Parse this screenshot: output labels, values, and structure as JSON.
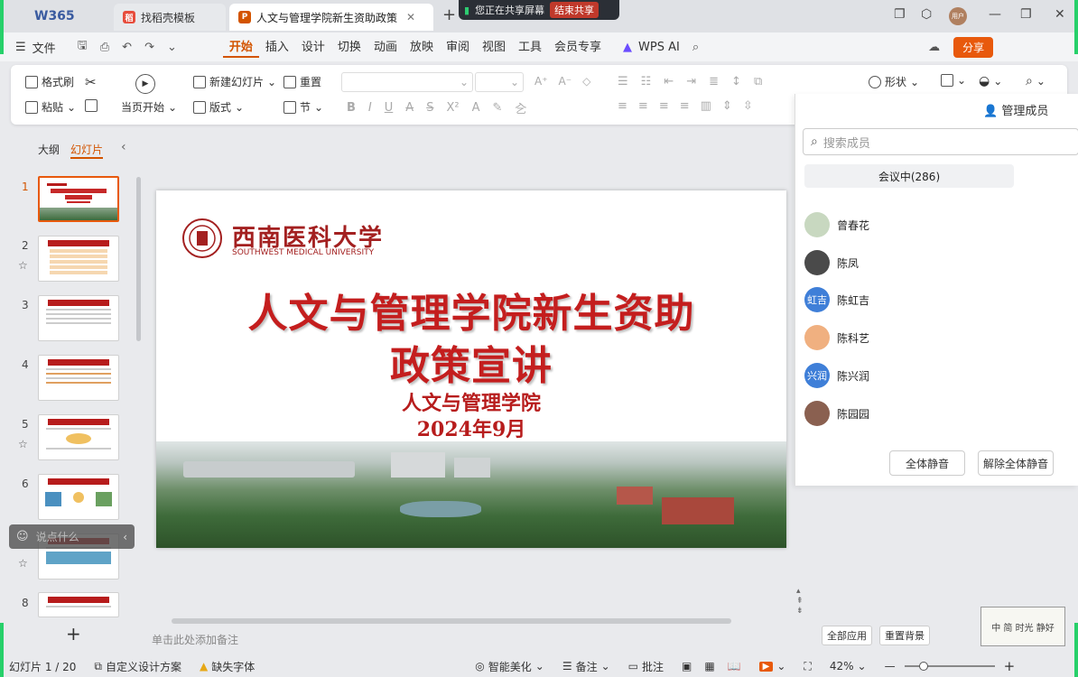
{
  "titlebar": {
    "logo": "W365",
    "tabs": [
      {
        "label": "找稻壳模板",
        "active": false
      },
      {
        "label": "人文与管理学院新生资助政策",
        "active": true
      }
    ],
    "share": {
      "status": "您正在共享屏幕",
      "end_label": "结束共享"
    },
    "user_avatar": "用户"
  },
  "menu": {
    "file": "文件",
    "items": [
      "开始",
      "插入",
      "设计",
      "切换",
      "动画",
      "放映",
      "审阅",
      "视图",
      "工具",
      "会员专享"
    ],
    "active": "开始",
    "ai": "WPS AI",
    "share_button": "分享"
  },
  "ribbon": {
    "format_painter": "格式刷",
    "paste": "粘贴",
    "play_from_current": "当页开始",
    "new_slide": "新建幻灯片",
    "layout": "版式",
    "reset": "重置",
    "section": "节",
    "shape": "形状"
  },
  "sidebar": {
    "tab_outline": "大纲",
    "tab_slides": "幻灯片",
    "slide_numbers": [
      "1",
      "2",
      "3",
      "4",
      "5",
      "6",
      "7",
      "8"
    ],
    "comment_placeholder": "说点什么"
  },
  "slide": {
    "university_cn": "西南医科大学",
    "university_en": "SOUTHWEST MEDICAL UNIVERSITY",
    "title_line1": "人文与管理学院新生资助",
    "title_line2": "政策宣讲",
    "subtitle": "人文与管理学院",
    "date": "2024年9月"
  },
  "notes_placeholder": "单击此处添加备注",
  "panel": {
    "title": "管理成员",
    "search_placeholder": "搜索成员",
    "tab_in_meeting": "会议中(286)",
    "members": [
      {
        "name": "曾春花",
        "avatar_text": "",
        "color": "#c8d8c0"
      },
      {
        "name": "陈凤",
        "avatar_text": "",
        "color": "#4a4a4a"
      },
      {
        "name": "陈虹吉",
        "avatar_text": "虹吉",
        "color": "#3f7fd8"
      },
      {
        "name": "陈科艺",
        "avatar_text": "",
        "color": "#f0b080"
      },
      {
        "name": "陈兴润",
        "avatar_text": "兴润",
        "color": "#3f7fd8"
      },
      {
        "name": "陈园园",
        "avatar_text": "",
        "color": "#8a6050"
      }
    ],
    "mute_all": "全体静音",
    "unmute_all": "解除全体静音"
  },
  "bottom_buttons": {
    "apply_all": "全部应用",
    "reset_bg": "重置背景"
  },
  "watermark": {
    "text": "中 简 时光 静好"
  },
  "status": {
    "slide_count": "幻灯片 1 / 20",
    "design_scheme": "自定义设计方案",
    "missing_font": "缺失字体",
    "beautify": "智能美化",
    "notes": "备注",
    "comments": "批注",
    "zoom": "42%"
  }
}
